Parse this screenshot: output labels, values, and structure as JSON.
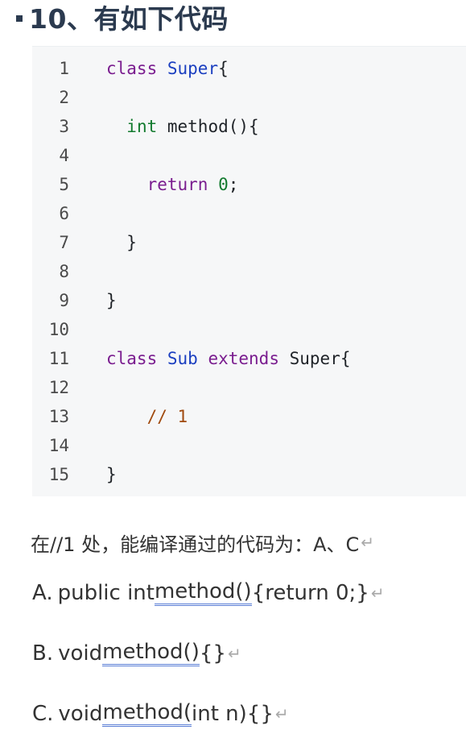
{
  "heading": {
    "text": "10、有如下代码"
  },
  "code": {
    "lines": [
      {
        "n": "1",
        "tokens": [
          {
            "c": "kw",
            "t": "class"
          },
          {
            "c": "punc",
            "t": " "
          },
          {
            "c": "type",
            "t": "Super"
          },
          {
            "c": "punc",
            "t": "{"
          }
        ]
      },
      {
        "n": "2",
        "tokens": []
      },
      {
        "n": "3",
        "tokens": [
          {
            "c": "punc",
            "t": "  "
          },
          {
            "c": "prim",
            "t": "int"
          },
          {
            "c": "punc",
            "t": " method(){"
          }
        ]
      },
      {
        "n": "4",
        "tokens": []
      },
      {
        "n": "5",
        "tokens": [
          {
            "c": "punc",
            "t": "    "
          },
          {
            "c": "kw",
            "t": "return"
          },
          {
            "c": "punc",
            "t": " "
          },
          {
            "c": "num",
            "t": "0"
          },
          {
            "c": "punc",
            "t": ";"
          }
        ]
      },
      {
        "n": "6",
        "tokens": []
      },
      {
        "n": "7",
        "tokens": [
          {
            "c": "punc",
            "t": "  }"
          }
        ]
      },
      {
        "n": "8",
        "tokens": []
      },
      {
        "n": "9",
        "tokens": [
          {
            "c": "punc",
            "t": "}"
          }
        ]
      },
      {
        "n": "10",
        "tokens": []
      },
      {
        "n": "11",
        "tokens": [
          {
            "c": "kw",
            "t": "class"
          },
          {
            "c": "punc",
            "t": " "
          },
          {
            "c": "type",
            "t": "Sub"
          },
          {
            "c": "punc",
            "t": " "
          },
          {
            "c": "kw",
            "t": "extends"
          },
          {
            "c": "punc",
            "t": " Super{"
          }
        ]
      },
      {
        "n": "12",
        "tokens": []
      },
      {
        "n": "13",
        "tokens": [
          {
            "c": "punc",
            "t": "    "
          },
          {
            "c": "cmt",
            "t": "// 1"
          }
        ]
      },
      {
        "n": "14",
        "tokens": []
      },
      {
        "n": "15",
        "tokens": [
          {
            "c": "punc",
            "t": "}"
          }
        ]
      }
    ]
  },
  "question": {
    "text": "在//1 处，能编译通过的代码为：A、C",
    "return_mark": "↵"
  },
  "options": [
    {
      "letter": "A.",
      "before": "public int ",
      "underlined": "method()",
      "after": "{return 0;}",
      "return_mark": "↵"
    },
    {
      "letter": "B.",
      "before": "void ",
      "underlined": "method()",
      "after": "{}",
      "return_mark": "↵"
    },
    {
      "letter": "C.",
      "before": "void ",
      "underlined": "method(",
      "after": "int n){}",
      "return_mark": "↵"
    }
  ]
}
